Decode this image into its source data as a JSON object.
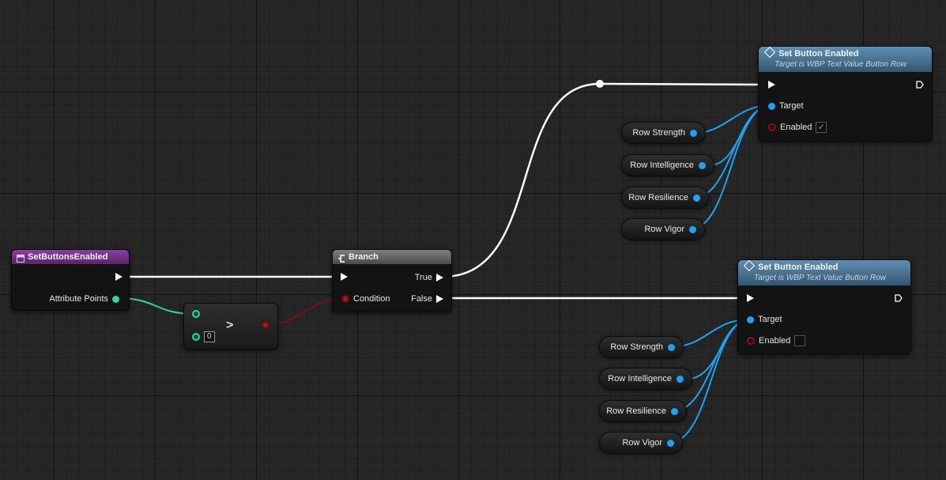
{
  "nodes": {
    "event": {
      "title": "SetButtonsEnabled",
      "pin_attribute": "Attribute Points"
    },
    "compare": {
      "operator": ">",
      "default_value": "0"
    },
    "branch": {
      "title": "Branch",
      "condition": "Condition",
      "true": "True",
      "false": "False"
    },
    "set_top": {
      "title": "Set Button Enabled",
      "subtitle": "Target is WBP Text Value Button Row",
      "target": "Target",
      "enabled": "Enabled",
      "enabled_checked": true,
      "check_glyph": "✓"
    },
    "set_bottom": {
      "title": "Set Button Enabled",
      "subtitle": "Target is WBP Text Value Button Row",
      "target": "Target",
      "enabled": "Enabled",
      "enabled_checked": false
    }
  },
  "vars_top": [
    "Row Strength",
    "Row Intelligence",
    "Row Resilience",
    "Row Vigor"
  ],
  "vars_bottom": [
    "Row Strength",
    "Row Intelligence",
    "Row Resilience",
    "Row Vigor"
  ],
  "colors": {
    "exec_wire": "#ffffff",
    "object_wire": "#1ca4f2",
    "int_wire": "#2ed3a6",
    "bool_wire": "#7a1010"
  }
}
